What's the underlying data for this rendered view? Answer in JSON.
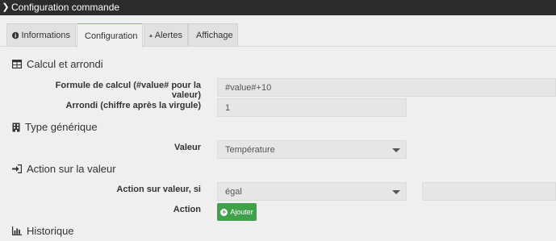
{
  "window": {
    "title": "Configuration commande"
  },
  "tabs": [
    {
      "label": "Informations",
      "icon": "info-circle-icon"
    },
    {
      "label": "Configuration",
      "icon": "wrench-icon",
      "active": true
    },
    {
      "label": "Alertes",
      "icon": "warning-icon"
    },
    {
      "label": "Affichage",
      "icon": "monitor-icon"
    }
  ],
  "sections": {
    "calc": "Calcul et arrondi",
    "generic": "Type générique",
    "action": "Action sur la valeur",
    "history": "Historique"
  },
  "fields": {
    "formula_label": "Formule de calcul (#value# pour la valeur)",
    "formula_value": "#value#+10",
    "round_label": "Arrondi (chiffre après la virgule)",
    "round_value": "1",
    "valeur_label": "Valeur",
    "valeur_value": "Température",
    "action_if_label": "Action sur valeur, si",
    "action_if_value": "égal",
    "action_if_compare": "",
    "action_label": "Action",
    "add_button": "Ajouter"
  },
  "colors": {
    "titlebar": "#2c2c2c",
    "active_tab_accent": "#94ca02",
    "add_button": "#3fa24b",
    "background": "#efefef"
  }
}
